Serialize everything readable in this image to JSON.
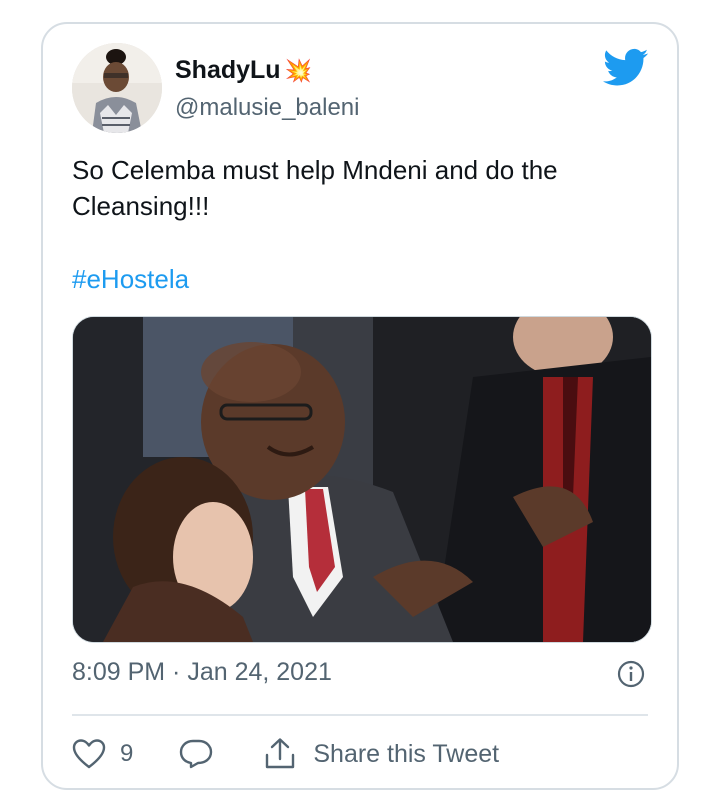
{
  "tweet": {
    "display_name": "ShadyLu",
    "name_emoji": "💥",
    "handle": "@malusie_baleni",
    "text": "So  Celemba must help Mndeni and do the Cleansing!!!",
    "hashtag": "#eHostela",
    "timestamp": "8:09 PM · Jan 24, 2021",
    "likes": "9",
    "share_label": "Share this Tweet"
  },
  "icons": {
    "platform": "twitter-bird-icon",
    "info": "info-icon",
    "like": "heart-icon",
    "reply": "reply-bubble-icon",
    "share": "share-icon"
  },
  "colors": {
    "accent": "#1d9bf0",
    "muted": "#536471",
    "border": "#d6dde3"
  }
}
